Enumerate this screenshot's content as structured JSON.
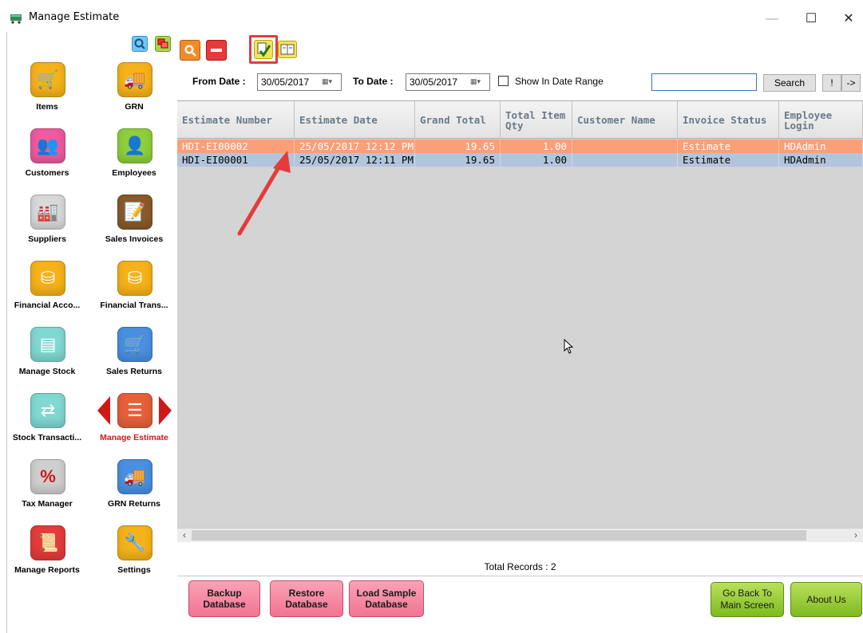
{
  "window": {
    "title": "Manage Estimate",
    "controls": {
      "minimize": "—",
      "maximize": "☐",
      "close": "✕"
    }
  },
  "sidebar": {
    "items": [
      {
        "label": "Items",
        "icon": "shopping-cart-icon",
        "color": "#f6b21a"
      },
      {
        "label": "GRN",
        "icon": "delivery-truck-icon",
        "color": "#f6b21a"
      },
      {
        "label": "Customers",
        "icon": "users-icon",
        "color": "#ef5aa0"
      },
      {
        "label": "Employees",
        "icon": "person-icon",
        "color": "#8fcf3c"
      },
      {
        "label": "Suppliers",
        "icon": "factory-icon",
        "color": "#d9d9d9"
      },
      {
        "label": "Sales Invoices",
        "icon": "invoice-edit-icon",
        "color": "#8a5a2b"
      },
      {
        "label": "Financial Acco...",
        "icon": "coins-icon",
        "color": "#f6b21a"
      },
      {
        "label": "Financial Trans...",
        "icon": "coins-transfer-icon",
        "color": "#f6b21a"
      },
      {
        "label": "Manage Stock",
        "icon": "stock-boxes-icon",
        "color": "#7fd9d2"
      },
      {
        "label": "Sales Returns",
        "icon": "cart-return-icon",
        "color": "#4a90e2"
      },
      {
        "label": "Stock Transacti...",
        "icon": "stock-transfer-icon",
        "color": "#7fd9d2"
      },
      {
        "label": "Manage Estimate",
        "icon": "estimate-document-icon",
        "color": "#e8603a"
      },
      {
        "label": "Tax Manager",
        "icon": "percent-icon",
        "color": "#cfcfcf"
      },
      {
        "label": "GRN Returns",
        "icon": "truck-return-icon",
        "color": "#4a90e2"
      },
      {
        "label": "Manage Reports",
        "icon": "reports-scroll-icon",
        "color": "#e53b3b"
      },
      {
        "label": "Settings",
        "icon": "tools-icon",
        "color": "#f6b21a"
      }
    ]
  },
  "filters": {
    "from_label": "From Date :",
    "from_value": "30/05/2017",
    "to_label": "To Date :",
    "to_value": "30/05/2017",
    "range_label": "Show In Date Range",
    "range_checked": false,
    "search_value": "",
    "search_button": "Search",
    "bang_button": "!",
    "arrow_button": "->"
  },
  "grid": {
    "columns": [
      "Estimate Number",
      "Estimate Date",
      "Grand Total",
      "Total Item Qty",
      "Customer Name",
      "Invoice Status",
      "Employee Login"
    ],
    "rows": [
      {
        "estimate_number": "HDI-EI00002",
        "estimate_date": "25/05/2017 12:12 PM",
        "grand_total": "19.65",
        "total_item_qty": "1.00",
        "customer_name": "",
        "invoice_status": "Estimate",
        "employee_login": "HDAdmin",
        "selected": true
      },
      {
        "estimate_number": "HDI-EI00001",
        "estimate_date": "25/05/2017 12:11 PM",
        "grand_total": "19.65",
        "total_item_qty": "1.00",
        "customer_name": "",
        "invoice_status": "Estimate",
        "employee_login": "HDAdmin",
        "selected": false
      }
    ]
  },
  "total_records": "Total Records : 2",
  "buttons": {
    "backup": "Backup Database",
    "restore": "Restore Database",
    "load_sample": "Load Sample Database",
    "go_back": "Go Back To Main Screen",
    "about": "About Us"
  },
  "colors": {
    "selected_row": "#fa9f78",
    "normal_row": "#b3c5dc",
    "grid_bg": "#d4d4d4",
    "annotation_red": "#e53b3b",
    "pink_button": "#f27493",
    "green_button": "#8cc62a"
  }
}
